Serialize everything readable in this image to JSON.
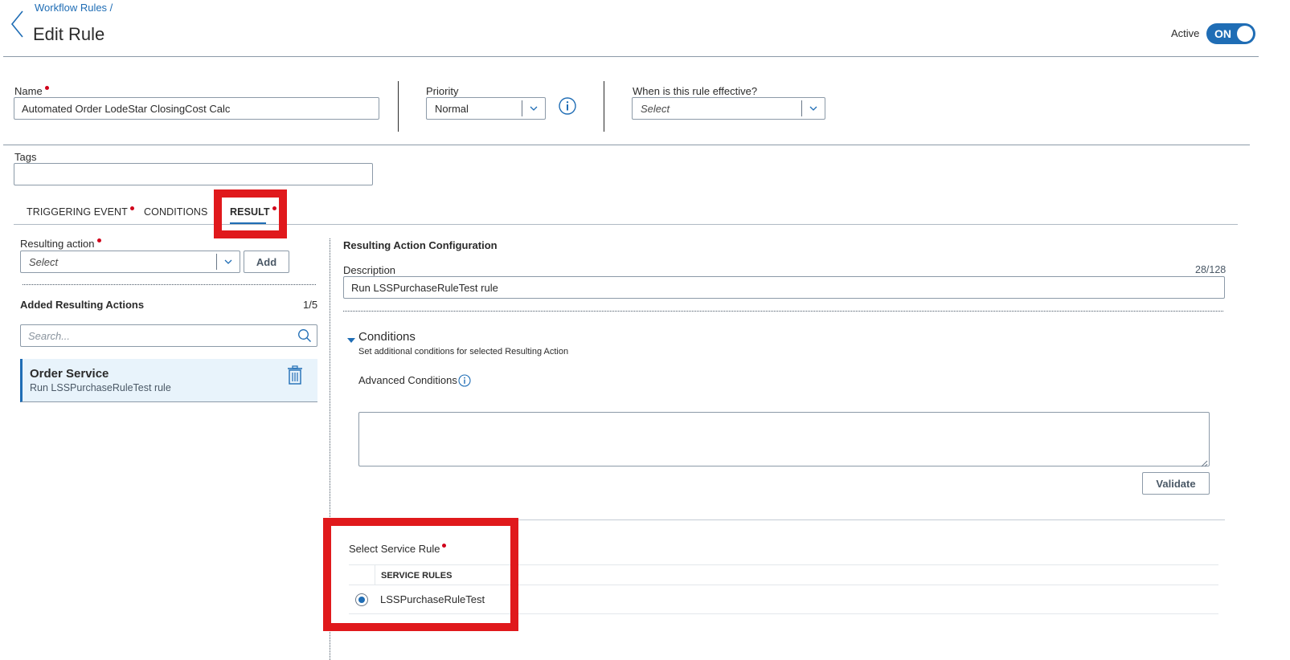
{
  "header": {
    "breadcrumb": "Workflow Rules /",
    "title": "Edit Rule",
    "active_label": "Active",
    "toggle_label": "ON"
  },
  "form": {
    "name_label": "Name",
    "name_value": "Automated Order LodeStar ClosingCost Calc",
    "priority_label": "Priority",
    "priority_value": "Normal",
    "effective_label": "When is this rule effective?",
    "effective_placeholder": "Select",
    "tags_label": "Tags",
    "tags_value": ""
  },
  "tabs": [
    {
      "label": "TRIGGERING EVENT",
      "required": true,
      "active": false
    },
    {
      "label": "CONDITIONS",
      "required": false,
      "active": false
    },
    {
      "label": "RESULT",
      "required": true,
      "active": true
    }
  ],
  "left_panel": {
    "resulting_action_label": "Resulting action",
    "resulting_action_placeholder": "Select",
    "add_button": "Add",
    "added_title": "Added Resulting Actions",
    "added_count": "1/5",
    "search_placeholder": "Search...",
    "items": [
      {
        "title": "Order Service",
        "subtitle": "Run LSSPurchaseRuleTest rule"
      }
    ]
  },
  "right_panel": {
    "title": "Resulting Action Configuration",
    "description_label": "Description",
    "description_counter": "28/128",
    "description_value": "Run LSSPurchaseRuleTest rule",
    "conditions_title": "Conditions",
    "conditions_subtitle": "Set additional conditions for selected Resulting Action",
    "advanced_label": "Advanced Conditions",
    "advanced_value": "",
    "validate_button": "Validate",
    "service_rule_label": "Select Service Rule",
    "service_rules_header": "SERVICE RULES",
    "service_rules": [
      {
        "name": "LSSPurchaseRuleTest",
        "selected": true
      }
    ]
  },
  "colors": {
    "accent": "#1f6db5",
    "required_dot": "#d0021b",
    "highlight_box": "#e0191c",
    "selected_item_bg": "#e8f3fb"
  }
}
